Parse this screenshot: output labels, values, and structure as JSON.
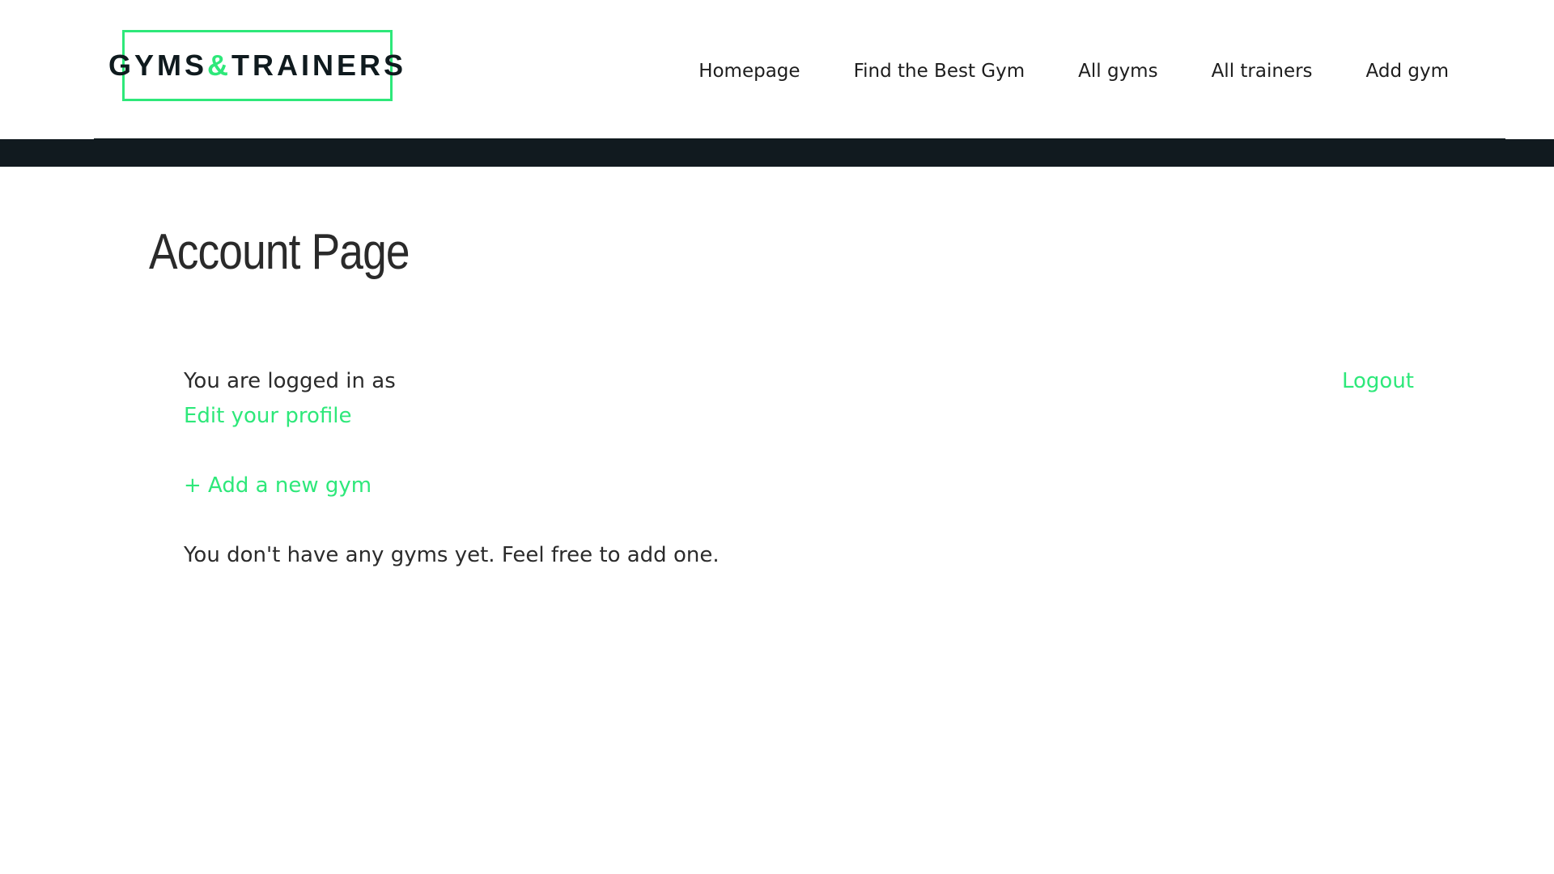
{
  "header": {
    "logo": {
      "part1": "GYMS",
      "amp": "&",
      "part2": "TRAINERS"
    },
    "nav": [
      {
        "label": "Homepage"
      },
      {
        "label": "Find the Best Gym"
      },
      {
        "label": "All gyms"
      },
      {
        "label": "All trainers"
      },
      {
        "label": "Add gym"
      }
    ]
  },
  "main": {
    "title": "Account Page",
    "logged_in_text": "You are logged in as",
    "edit_profile_label": "Edit your profile",
    "logout_label": "Logout",
    "add_gym_label": "+ Add a new gym",
    "empty_message": "You don't have any gyms yet. Feel free to add one."
  },
  "colors": {
    "accent": "#2ee87a",
    "dark_bar": "#111a1f",
    "text": "#2b2b2b"
  }
}
